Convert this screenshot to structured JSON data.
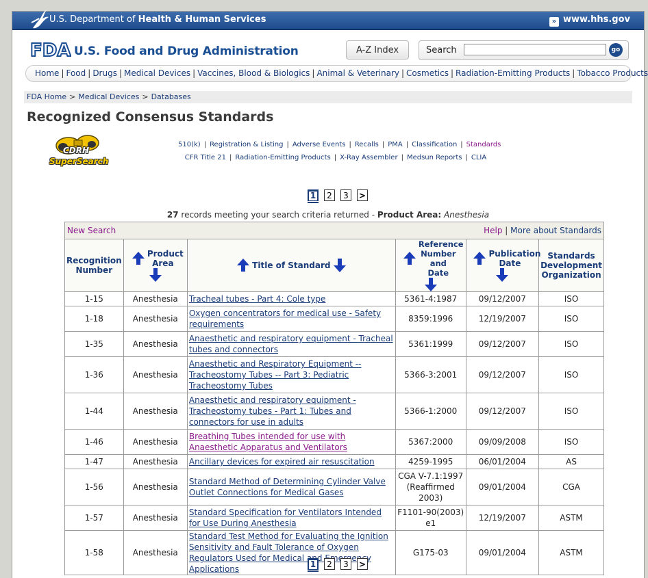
{
  "hhs": {
    "prefix": "U.S. Department of ",
    "bold": "Health & Human Services",
    "link": "www.hhs.gov"
  },
  "fda": {
    "logo": "FDA",
    "name": "U.S. Food and Drug Administration"
  },
  "header": {
    "az_index": "A-Z Index",
    "search_label": "Search",
    "search_value": "",
    "go": "go"
  },
  "nav": [
    "Home",
    "Food",
    "Drugs",
    "Medical Devices",
    "Vaccines, Blood & Biologics",
    "Animal & Veterinary",
    "Cosmetics",
    "Radiation-Emitting Products",
    "Tobacco Products"
  ],
  "breadcrumb": [
    "FDA Home",
    "Medical Devices",
    "Databases"
  ],
  "page_title": "Recognized Consensus Standards",
  "cdrh": {
    "line1": "CDRH",
    "line2": "SuperSearch"
  },
  "sublinks_row1": [
    "510(k)",
    "Registration & Listing",
    "Adverse Events",
    "Recalls",
    "PMA",
    "Classification",
    "Standards"
  ],
  "sublinks_row2": [
    "CFR Title 21",
    "Radiation-Emitting Products",
    "X-Ray Assembler",
    "Medsun Reports",
    "CLIA"
  ],
  "pager": {
    "pages": [
      "1",
      "2",
      "3",
      ">"
    ],
    "current": "1"
  },
  "records": {
    "count": "27",
    "text": " records meeting your search criteria returned - ",
    "area_label": "Product Area:",
    "area_value": "Anesthesia"
  },
  "toolbar": {
    "new_search": "New Search",
    "help": "Help",
    "more": "More about Standards"
  },
  "columns": [
    "Recognition Number",
    "Product Area",
    "Title of Standard",
    "Reference Number and Date",
    "Publication Date",
    "Standards Development Organization"
  ],
  "rows": [
    {
      "num": "1-15",
      "area": "Anesthesia",
      "title": "Tracheal tubes - Part 4: Cole type",
      "ref": "5361-4:1987",
      "date": "09/12/2007",
      "sdo": "ISO"
    },
    {
      "num": "1-18",
      "area": "Anesthesia",
      "title": "Oxygen concentrators for medical use - Safety requirements",
      "ref": "8359:1996",
      "date": "12/19/2007",
      "sdo": "ISO"
    },
    {
      "num": "1-35",
      "area": "Anesthesia",
      "title": "Anaesthetic and respiratory equipment - Tracheal tubes and connectors",
      "ref": "5361:1999",
      "date": "09/12/2007",
      "sdo": "ISO"
    },
    {
      "num": "1-36",
      "area": "Anesthesia",
      "title": "Anaesthetic and Respiratory Equipment -- Tracheostomy Tubes -- Part 3: Pediatric Tracheostomy Tubes",
      "ref": "5366-3:2001",
      "date": "09/12/2007",
      "sdo": "ISO"
    },
    {
      "num": "1-44",
      "area": "Anesthesia",
      "title": "Anaesthetic and respiratory equipment - Tracheostomy tubes - Part 1: Tubes and connectors for use in adults",
      "ref": "5366-1:2000",
      "date": "09/12/2007",
      "sdo": "ISO"
    },
    {
      "num": "1-46",
      "area": "Anesthesia",
      "title": "Breathing Tubes intended for use with Anaesthetic Apparatus and Ventilators",
      "ref": "5367:2000",
      "date": "09/09/2008",
      "sdo": "ISO",
      "visited": true
    },
    {
      "num": "1-47",
      "area": "Anesthesia",
      "title": "Ancillary devices for expired air resuscitation",
      "ref": "4259-1995",
      "date": "06/01/2004",
      "sdo": "AS"
    },
    {
      "num": "1-56",
      "area": "Anesthesia",
      "title": "Standard Method of Determining Cylinder Valve Outlet Connections for Medical Gases",
      "ref": "CGA V-7.1:1997 (Reaffirmed 2003)",
      "date": "09/01/2004",
      "sdo": "CGA"
    },
    {
      "num": "1-57",
      "area": "Anesthesia",
      "title": "Standard Specification for Ventilators Intended for Use During Anesthesia",
      "ref": "F1101-90(2003) e1",
      "date": "12/19/2007",
      "sdo": "ASTM"
    },
    {
      "num": "1-58",
      "area": "Anesthesia",
      "title": "Standard Test Method for Evaluating the Ignition Sensitivity and Fault Tolerance of Oxygen Regulators Used for Medical and Emergency Applications",
      "ref": "G175-03",
      "date": "09/01/2004",
      "sdo": "ASTM"
    }
  ]
}
